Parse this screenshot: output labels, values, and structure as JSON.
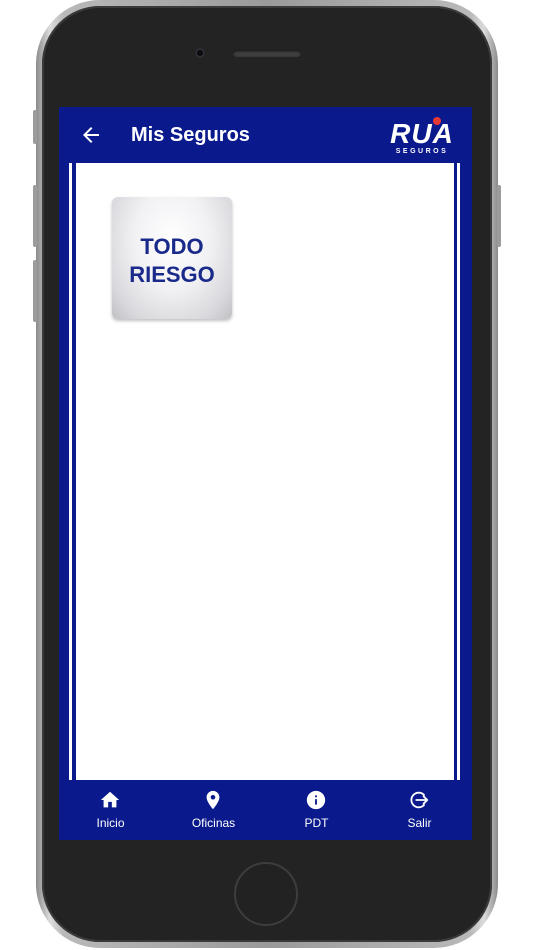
{
  "appbar": {
    "title": "Mis Seguros",
    "back_icon": "arrow-back-icon",
    "logo": {
      "text": "RUA",
      "subtext": "SEGUROS"
    }
  },
  "tiles": [
    {
      "label": "TODO\nRIESGO"
    }
  ],
  "bottom_nav": {
    "items": [
      {
        "label": "Inicio",
        "icon": "home-icon"
      },
      {
        "label": "Oficinas",
        "icon": "location-pin-icon"
      },
      {
        "label": "PDT",
        "icon": "info-icon"
      },
      {
        "label": "Salir",
        "icon": "logout-icon"
      }
    ]
  },
  "colors": {
    "primary": "#0a1a8c",
    "tile_text": "#1a2a8a",
    "logo_accent": "#e53935"
  }
}
